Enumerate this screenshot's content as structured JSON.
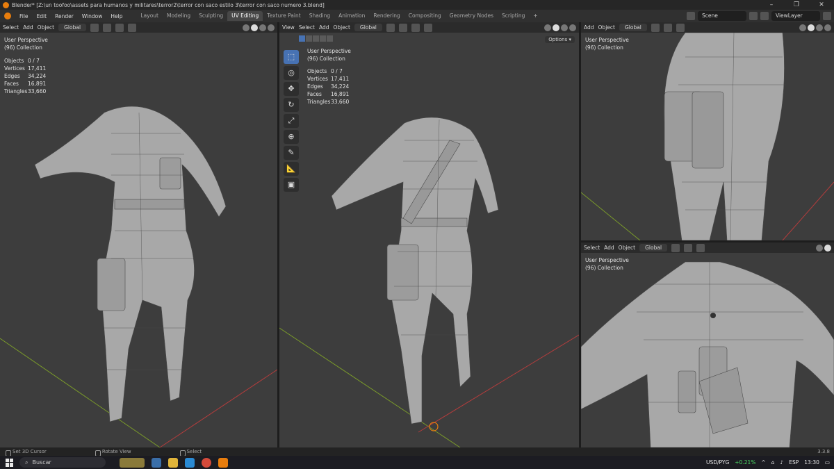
{
  "window": {
    "title": "Blender* [Z:\\un toofoo\\assets para humanos y militares\\terror2\\terror con saco estilo 3\\terror con saco numero 3.blend]",
    "controls": [
      "–",
      "❐",
      "✕"
    ]
  },
  "menu": [
    "File",
    "Edit",
    "Render",
    "Window",
    "Help"
  ],
  "workspaces": {
    "tabs": [
      "Layout",
      "Modeling",
      "Sculpting",
      "UV Editing",
      "Texture Paint",
      "Shading",
      "Animation",
      "Rendering",
      "Compositing",
      "Geometry Nodes",
      "Scripting"
    ],
    "active": "UV Editing",
    "add": "+"
  },
  "scene": {
    "name": "Scene",
    "view_layer": "ViewLayer"
  },
  "header": {
    "select": "Select",
    "add": "Add",
    "object": "Object",
    "view": "View",
    "orientation": "Global"
  },
  "overlay_text": {
    "perspective": "User Perspective",
    "collection": "(96) Collection",
    "options": "Options"
  },
  "stats": [
    {
      "label": "Objects",
      "value": "0 / 7"
    },
    {
      "label": "Vertices",
      "value": "17,411"
    },
    {
      "label": "Edges",
      "value": "34,224"
    },
    {
      "label": "Faces",
      "value": "16,891"
    },
    {
      "label": "Triangles",
      "value": "33,660"
    }
  ],
  "tools": [
    "select-box",
    "cursor",
    "move",
    "rotate",
    "scale",
    "transform",
    "annotate",
    "measure",
    "add-cube"
  ],
  "statusbar": {
    "hint1": "Set 3D Cursor",
    "hint2": "Rotate View",
    "hint3": "Select",
    "version": "3.3.8"
  },
  "taskbar": {
    "search": "Buscar",
    "currency": "USD/PYG",
    "change": "+0.21%",
    "language": "ESP",
    "time": "13:30"
  },
  "colors": {
    "accent": "#4772b3",
    "viewport_bg": "#3d3d3d",
    "x_axis": "#b33d3d",
    "y_axis": "#7a9a2a",
    "blender_orange": "#e87d0d"
  }
}
